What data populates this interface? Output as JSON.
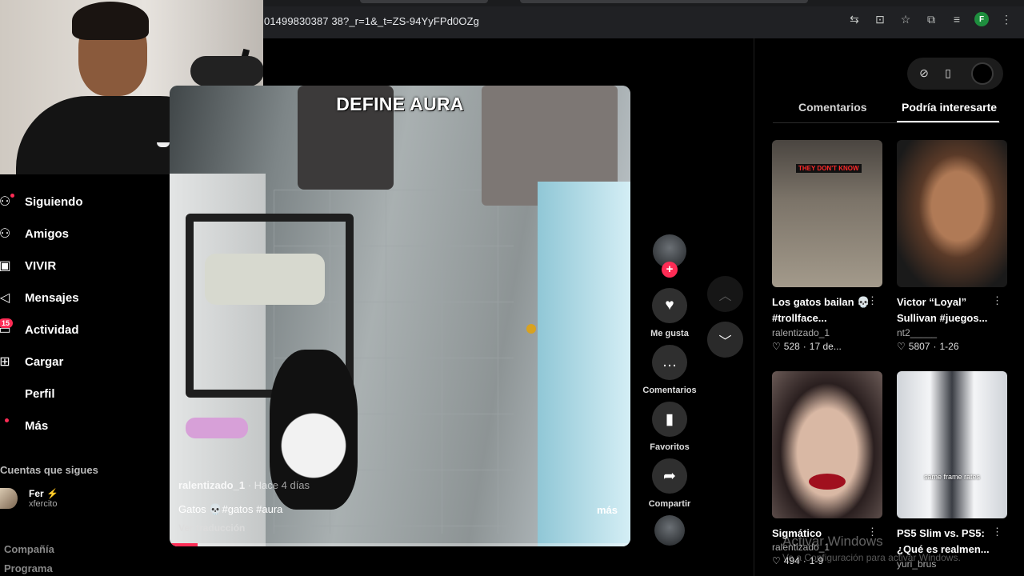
{
  "browser": {
    "url": "01499830387 38?_r=1&_t=ZS-94YyFPd0OZg",
    "icons": [
      "translate-icon",
      "install-icon",
      "star-icon",
      "extensions-icon",
      "media-icon",
      "profile-icon"
    ],
    "profile_initial": "F"
  },
  "sidebar": {
    "items": [
      {
        "label": "Siguiendo",
        "icon": "following-icon"
      },
      {
        "label": "Amigos",
        "icon": "friends-icon"
      },
      {
        "label": "VIVIR",
        "icon": "live-icon"
      },
      {
        "label": "Mensajes",
        "icon": "messages-icon"
      },
      {
        "label": "Actividad",
        "icon": "activity-icon",
        "badge": "15"
      },
      {
        "label": "Cargar",
        "icon": "upload-icon"
      },
      {
        "label": "Perfil",
        "icon": "profile-icon"
      },
      {
        "label": "Más",
        "icon": "more-icon"
      }
    ],
    "following_heading": "Cuentas que sigues",
    "followed_account": {
      "name": "Fer",
      "handle": "xfercito"
    },
    "footer": [
      "Compañía",
      "Programa"
    ]
  },
  "video": {
    "overlay_title": "DEFINE AURA",
    "author": "ralentizado_1",
    "time_ago": "· Hace 4 días",
    "caption": "Gatos 💀#gatos #aura",
    "more_label": "más",
    "translate_label": "Ver traducción",
    "progress": 0.06
  },
  "actions": {
    "like_label": "Me gusta",
    "comments_label": "Comentarios",
    "favorites_label": "Favoritos",
    "share_label": "Compartir"
  },
  "right_panel": {
    "tabs": [
      "Comentarios",
      "Podría interesarte"
    ],
    "active_tab": 1,
    "cards": [
      {
        "title": "Los gatos bailan 💀 #trollface...",
        "author": "ralentizado_1",
        "likes": "528",
        "date": "17 de...",
        "overlay_text": "THEY DON'T KNOW"
      },
      {
        "title": "Victor “Loyal” Sullivan #juegos...",
        "author": "nt2_____",
        "likes": "5807",
        "date": "1-26",
        "overlay_text": ""
      },
      {
        "title": "Sigmático",
        "author": "ralentizado_1",
        "likes": "494",
        "date": "1-9",
        "overlay_text": ""
      },
      {
        "title": "PS5 Slim vs. PS5: ¿Qué es realmen...",
        "author": "yuri_brus",
        "likes": "",
        "date": "",
        "overlay_text": "same frame rates"
      }
    ]
  },
  "watermark": {
    "title": "Activar Windows",
    "subtitle": "Ve a Configuración para activar Windows."
  },
  "colors": {
    "accent": "#fe2c55",
    "background": "#000000"
  }
}
